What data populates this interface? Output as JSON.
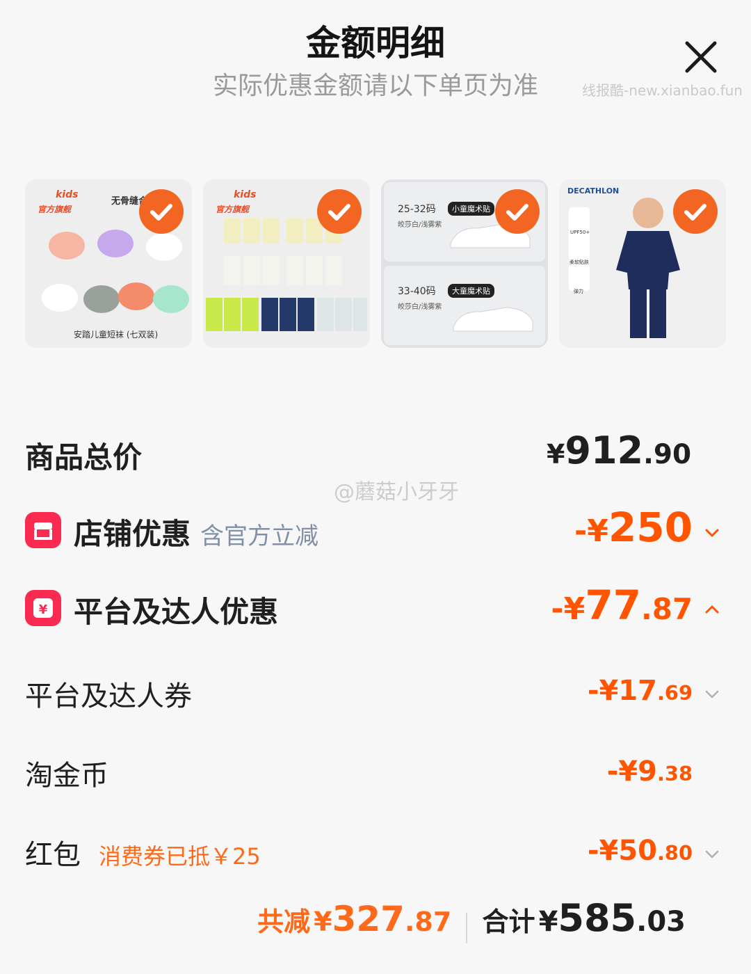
{
  "header": {
    "title": "金额明细",
    "subtitle": "实际优惠金额请以下单页为准",
    "watermark": "线报酷-new.xianbao.fun"
  },
  "products": [
    {
      "brand_line1": "kids",
      "brand_line2": "官方旗舰",
      "top_text": "无骨缝合",
      "caption": "安踏儿童短袜 (七双装)"
    },
    {
      "brand_line1": "kids",
      "brand_line2": "官方旗舰"
    },
    {
      "size_1": "25-32码",
      "tag_1": "小童魔术贴",
      "color_1": "皎莎白/浅雾紫",
      "size_2": "33-40码",
      "tag_2": "大童魔术贴",
      "color_2": "皎莎白/浅雾紫"
    },
    {
      "brand": "DECATHLON",
      "feature_1": "UPF50+",
      "feature_2": "柔软贴肤",
      "feature_3": "弹力"
    }
  ],
  "overlay_mark": "@蘑菇小牙牙",
  "rows": {
    "total": {
      "label": "商品总价",
      "currency": "¥",
      "int": "912",
      "dec": ".90"
    },
    "store": {
      "label": "店铺优惠",
      "sub": "含官方立减",
      "prefix": "-¥",
      "int": "250",
      "dec": ""
    },
    "platform": {
      "label": "平台及达人优惠",
      "prefix": "-¥",
      "int": "77",
      "dec": ".87"
    },
    "coupon": {
      "label": "平台及达人券",
      "prefix": "-¥",
      "int": "17",
      "dec": ".69"
    },
    "coins": {
      "label": "淘金币",
      "prefix": "-¥",
      "int": "9",
      "dec": ".38"
    },
    "redpacket": {
      "label": "红包",
      "note": "消费券已抵￥25",
      "prefix": "-¥",
      "int": "50",
      "dec": ".80"
    }
  },
  "footer": {
    "save_label": "共减",
    "save_currency": "¥",
    "save_int": "327",
    "save_dec": ".87",
    "total_label": "合计",
    "total_currency": "¥",
    "total_int": "585",
    "total_dec": ".03"
  },
  "colors": {
    "accent": "#ff5500",
    "check": "#f26522",
    "store_icon": "#fa2a50"
  }
}
